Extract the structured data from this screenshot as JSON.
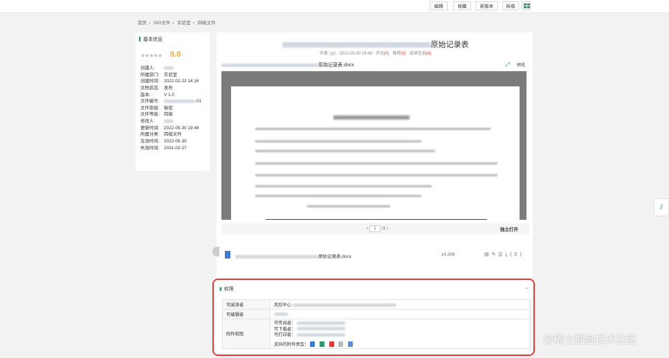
{
  "toolbar": {
    "buttons": [
      "编辑",
      "收藏",
      "新版本",
      "拆借"
    ],
    "grid_icon": "grid-icon"
  },
  "breadcrumb": [
    "首页",
    "ISO文件",
    "实验室",
    "四级文件"
  ],
  "basic_info": {
    "title": "基本信息",
    "stars": "★★★★★",
    "score": "0.0",
    "rows": [
      {
        "k": "创建人:",
        "v": ""
      },
      {
        "k": "所属部门:",
        "v": "实验室"
      },
      {
        "k": "创建时间:",
        "v": "2022-02-22 14:16"
      },
      {
        "k": "文档状态:",
        "v": "发布"
      },
      {
        "k": "版本:",
        "v": "V 1.0"
      },
      {
        "k": "文件编号:",
        "v": "-01"
      },
      {
        "k": "文件密级:",
        "v": "秘密"
      },
      {
        "k": "文件等级:",
        "v": "四级"
      },
      {
        "k": "修改人:",
        "v": ""
      },
      {
        "k": "更新时间:",
        "v": "2022-05-30 19:48"
      },
      {
        "k": "所属分类:",
        "v": "四级文件"
      },
      {
        "k": "生效时间:",
        "v": "2022-05-30"
      },
      {
        "k": "失效时间:",
        "v": "2031-02-27"
      }
    ]
  },
  "document": {
    "title": "原始记录表",
    "meta_author": "作者",
    "meta_time": "2022-05-30 19:48",
    "meta_comment": "评论",
    "meta_comment_count": "(0)",
    "meta_like": "推荐",
    "meta_like_count": "(0)",
    "meta_read": "阅读信息",
    "meta_read_count": "(4)"
  },
  "preview": {
    "file_name": "原始记录表.docx",
    "preview_label": "预览",
    "page_current": "1",
    "page_total": "/1",
    "open_label": "独立打开"
  },
  "attachment": {
    "name": "原始记录表.docx",
    "size": "14.2KB",
    "download_count": "(0)"
  },
  "permission": {
    "title": "权限",
    "rows": [
      {
        "k": "可阅读者",
        "v": "风控中心"
      },
      {
        "k": "可编辑者",
        "v": ""
      },
      {
        "k": "附件权限",
        "v": ""
      }
    ],
    "sub_reader": "可传阅者：",
    "sub_download": "可下载者：",
    "sub_print": "可打印者：",
    "types_label": "支持的附件类型："
  },
  "watermark": "@稀土掘金技术社区",
  "colors": {
    "accent": "#2e9a6b",
    "score": "#f5a623",
    "highlight": "#e53935",
    "link": "#3b7bd6"
  }
}
